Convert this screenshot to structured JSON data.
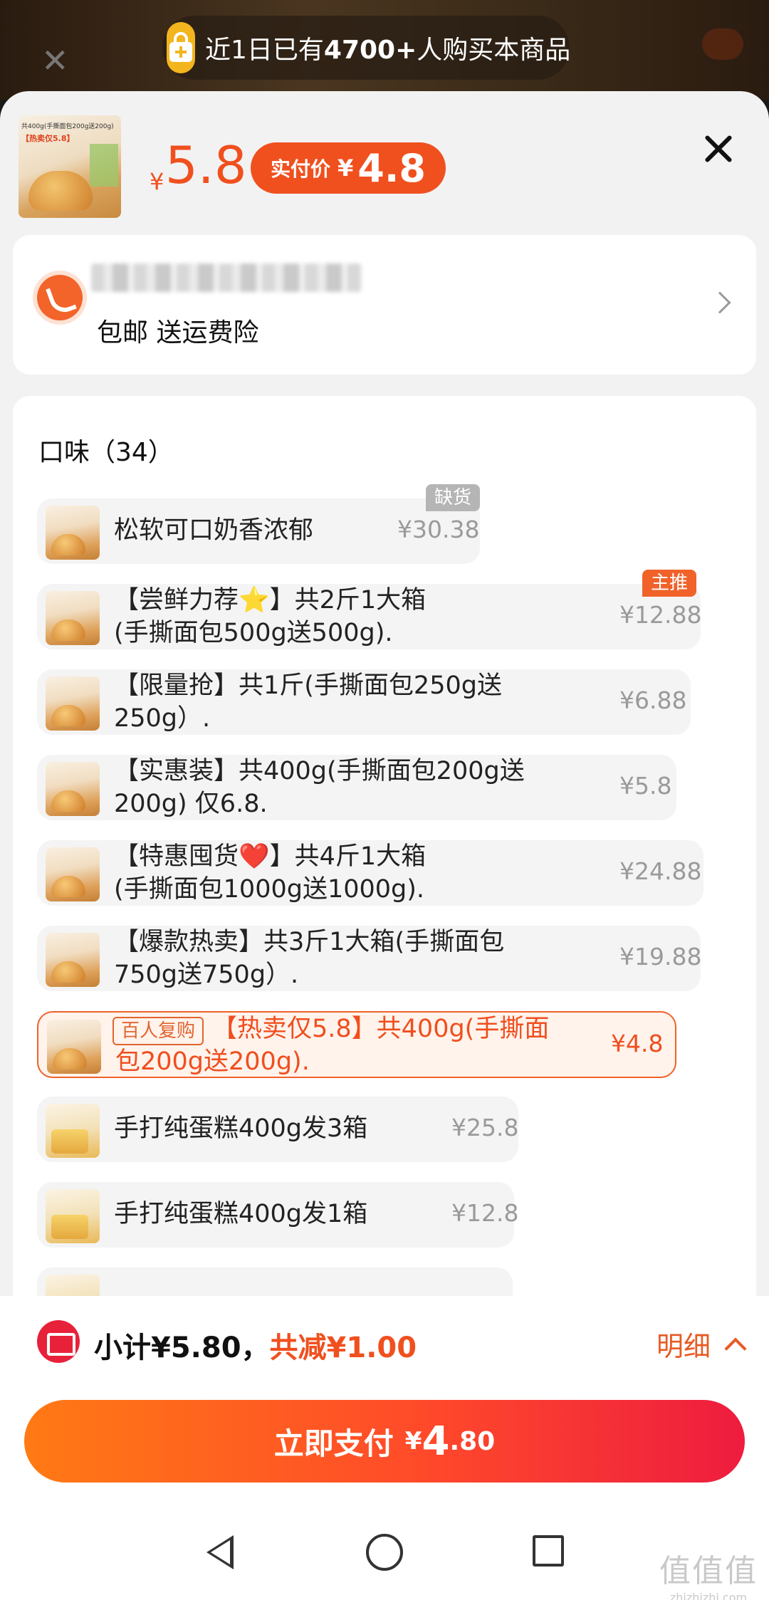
{
  "notice": {
    "prefix": "近1日已有",
    "count": "4700+",
    "suffix": "人购买本商品"
  },
  "product": {
    "thumb_band": "共400g(手撕面包200g送200g)",
    "thumb_label": "【热卖仅5.8】",
    "price_currency": "¥",
    "price": "5.8",
    "real_price_label": "实付价",
    "real_price_currency": "¥",
    "real_price": "4.8"
  },
  "address": {
    "shipping_text": "包邮 送运费险"
  },
  "options": {
    "title": "口味（34）",
    "items": [
      {
        "text": "松软可口奶香浓郁",
        "price": "¥30.38",
        "tag": "缺货"
      },
      {
        "text": "【尝鲜力荐⭐】共2斤1大箱(手撕面包500g送500g).",
        "price": "¥12.88",
        "tag": "主推"
      },
      {
        "text": "【限量抢】共1斤(手撕面包250g送250g）.",
        "price": "¥6.88"
      },
      {
        "text": "【实惠装】共400g(手撕面包200g送200g) 仅6.8.",
        "price": "¥5.8"
      },
      {
        "text": "【特惠囤货❤️】共4斤1大箱(手撕面包1000g送1000g).",
        "price": "¥24.88"
      },
      {
        "text": "【爆款热卖】共3斤1大箱(手撕面包750g送750g）.",
        "price": "¥19.88"
      },
      {
        "text": "【热卖仅5.8】共400g(手撕面包200g送200g).",
        "price": "¥4.8",
        "tag": "百人复购",
        "selected": true
      },
      {
        "text": "手打纯蛋糕400g发3箱",
        "price": "¥25.8"
      },
      {
        "text": "手打纯蛋糕400g发1箱",
        "price": "¥12.8"
      }
    ]
  },
  "footer": {
    "subtotal": "小计¥5.80，",
    "discount": "共减¥1.00",
    "detail_label": "明细",
    "pay_label": "立即支付",
    "pay_currency": "¥",
    "pay_int": "4",
    "pay_dec": ".80"
  },
  "watermark": {
    "main": "值值值",
    "sub": "zhizhizhi.com"
  },
  "colors": {
    "accent": "#f0501e",
    "pay_gradient_start": "#ff7a14",
    "pay_gradient_end": "#ee1c3f"
  }
}
